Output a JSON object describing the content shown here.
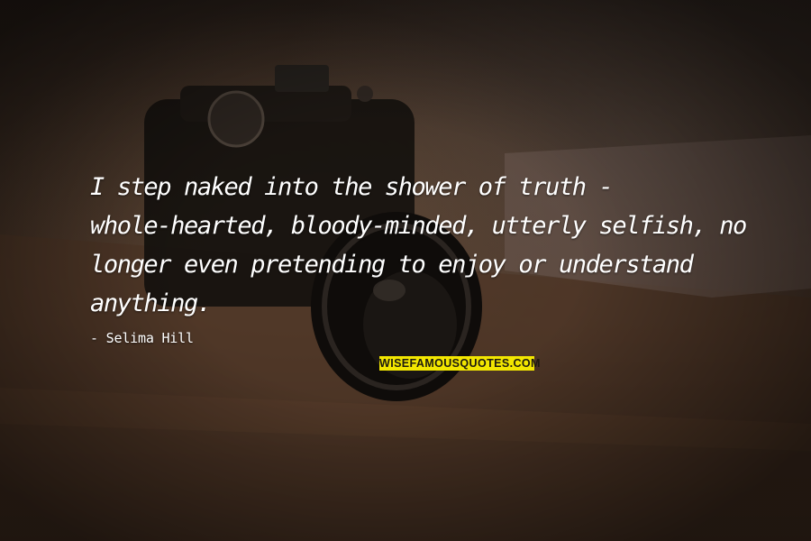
{
  "quote": {
    "lines": [
      "I step naked into the shower of truth -",
      "whole-hearted, bloody-minded, utterly selfish, no",
      "longer even pretending to enjoy or understand",
      "anything."
    ]
  },
  "author": "- Selima Hill",
  "watermark": "WISEFAMOUSQUOTES.COM",
  "colors": {
    "text": "#ffffff",
    "watermark_bg": "#f2e600",
    "background": "#3d2d22"
  }
}
